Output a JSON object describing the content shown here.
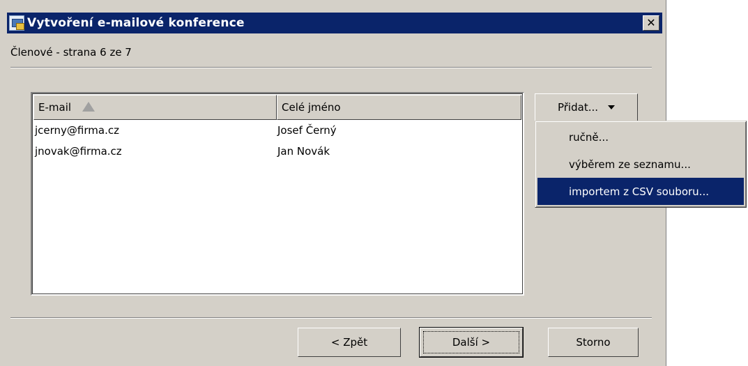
{
  "window": {
    "title": "Vytvoření e-mailové konference",
    "close_label": "✕"
  },
  "page": {
    "subtitle": "Členové - strana 6 ze 7"
  },
  "list": {
    "columns": [
      "E-mail",
      "Celé jméno"
    ],
    "rows": [
      {
        "email": "jcerny@firma.cz",
        "name": "Josef Černý"
      },
      {
        "email": "jnovak@firma.cz",
        "name": "Jan Novák"
      }
    ]
  },
  "add_button": {
    "label": "Přidat..."
  },
  "add_menu": {
    "items": [
      "ručně...",
      "výběrem ze seznamu...",
      "importem z CSV souboru..."
    ],
    "highlighted_index": 2
  },
  "footer": {
    "back_label": "< Zpět",
    "next_label": "Další >",
    "cancel_label": "Storno"
  },
  "colors": {
    "dialog_bg": "#d4d0c8",
    "titlebar": "#0a246a",
    "highlight": "#0a246a"
  }
}
